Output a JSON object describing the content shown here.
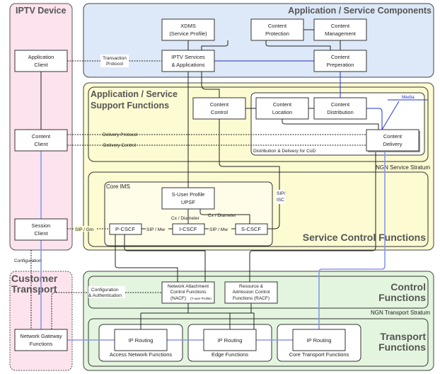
{
  "panels": {
    "iptv_device": "IPTV Device",
    "app_components": "Application / Service Components",
    "app_support_1": "Application / Service",
    "app_support_2": "Support Functions",
    "service_control": "Service Control Functions",
    "core_ims": "Core IMS",
    "customer_1": "Customer",
    "customer_2": "Transport",
    "control_1": "Control",
    "control_2": "Functions",
    "transport_1": "Transport",
    "transport_2": "Functions",
    "ngn_service": "NGN Service Stratum",
    "ngn_transport": "NGN Transport Stratum",
    "cod": "Distribution & Delivery for CoD"
  },
  "boxes": {
    "xdms": [
      "XDMS",
      "(Service Profile)"
    ],
    "protection": [
      "Content",
      "Protection"
    ],
    "management": [
      "Content",
      "Management"
    ],
    "app_client": [
      "Application",
      "Client"
    ],
    "iptv_services": [
      "IPTV Services",
      "& Applications"
    ],
    "preparation": [
      "Content",
      "Preperation"
    ],
    "control": [
      "Content",
      "Control"
    ],
    "location": [
      "Content",
      "Location"
    ],
    "distribution": [
      "Content",
      "Distribution"
    ],
    "content_client": [
      "Content",
      "Client"
    ],
    "delivery": [
      "Content",
      "Delivery"
    ],
    "upsf": [
      "S-User Profile",
      "UPSF"
    ],
    "session_client": [
      "Session",
      "Client"
    ],
    "pcscf": "P-CSCF",
    "icscf": "I-CSCF",
    "scscf": "S-CSCF",
    "nacf": [
      "Network Attachment",
      "Control Functions",
      "(NACF)",
      "(T-user Profile)"
    ],
    "racf": [
      "Resource &",
      "Admission Control",
      "Functions (RACF)"
    ],
    "ngw": [
      "Network Gateway",
      "Functions"
    ],
    "ip_routing": "IP Routing",
    "access": "Access Network Functions",
    "edge": "Edge Functions",
    "core": "Core Transport Functions"
  },
  "links": {
    "transaction": [
      "Transaction",
      "Protocol"
    ],
    "delivery_protocol": "Delivery Protocol",
    "delivery_control": "Delivery Control",
    "media": "Media",
    "sip_gm": "SIP / Gm",
    "sip_mw1": "SIP / Mw",
    "sip_mw2": "SIP / Mw",
    "cx1": "Cx / Diameter",
    "cx2": "Cx / Diameter",
    "sip_isc": [
      "SIP/",
      "ISC"
    ],
    "configuration": "Configuration",
    "config_auth": [
      "Configuration",
      "& Authentication"
    ]
  },
  "colors": {
    "device": "#fde3ee",
    "components": "#dde9f8",
    "service": "#fdfbd2",
    "transport": "#e4f5df",
    "media_line": "#2233cc"
  }
}
